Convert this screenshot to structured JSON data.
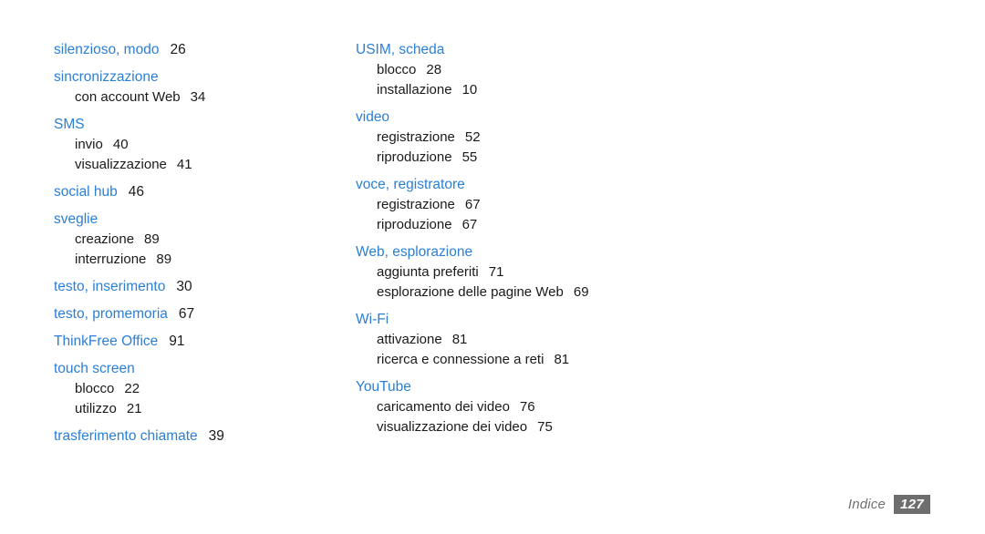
{
  "document": {
    "type": "index-page",
    "language": "it",
    "accent_color": "#2b7fd4",
    "text_color": "#1a1a1a",
    "footer_gray": "#707070",
    "background": "#ffffff"
  },
  "columns": {
    "left": [
      {
        "heading": "silenzioso, modo",
        "page": "26",
        "subentries": []
      },
      {
        "heading": "sincronizzazione",
        "page": "",
        "subentries": [
          {
            "term": "con account Web",
            "page": "34"
          }
        ]
      },
      {
        "heading": "SMS",
        "page": "",
        "subentries": [
          {
            "term": "invio",
            "page": "40"
          },
          {
            "term": "visualizzazione",
            "page": "41"
          }
        ]
      },
      {
        "heading": "social hub",
        "page": "46",
        "subentries": []
      },
      {
        "heading": "sveglie",
        "page": "",
        "subentries": [
          {
            "term": "creazione",
            "page": "89"
          },
          {
            "term": "interruzione",
            "page": "89"
          }
        ]
      },
      {
        "heading": "testo, inserimento",
        "page": "30",
        "subentries": []
      },
      {
        "heading": "testo, promemoria",
        "page": "67",
        "subentries": []
      },
      {
        "heading": "ThinkFree Office",
        "page": "91",
        "subentries": []
      },
      {
        "heading": "touch screen",
        "page": "",
        "subentries": [
          {
            "term": "blocco",
            "page": "22"
          },
          {
            "term": "utilizzo",
            "page": "21"
          }
        ]
      },
      {
        "heading": "trasferimento chiamate",
        "page": "39",
        "subentries": []
      }
    ],
    "right": [
      {
        "heading": "USIM, scheda",
        "page": "",
        "subentries": [
          {
            "term": "blocco",
            "page": "28"
          },
          {
            "term": "installazione",
            "page": "10"
          }
        ]
      },
      {
        "heading": "video",
        "page": "",
        "subentries": [
          {
            "term": "registrazione",
            "page": "52"
          },
          {
            "term": "riproduzione",
            "page": "55"
          }
        ]
      },
      {
        "heading": "voce, registratore",
        "page": "",
        "subentries": [
          {
            "term": "registrazione",
            "page": "67"
          },
          {
            "term": "riproduzione",
            "page": "67"
          }
        ]
      },
      {
        "heading": "Web, esplorazione",
        "page": "",
        "subentries": [
          {
            "term": "aggiunta preferiti",
            "page": "71"
          },
          {
            "term": "esplorazione delle pagine Web",
            "page": "69"
          }
        ]
      },
      {
        "heading": "Wi-Fi",
        "page": "",
        "subentries": [
          {
            "term": "attivazione",
            "page": "81"
          },
          {
            "term": "ricerca e connessione a reti",
            "page": "81"
          }
        ]
      },
      {
        "heading": "YouTube",
        "page": "",
        "subentries": [
          {
            "term": "caricamento dei video",
            "page": "76"
          },
          {
            "term": "visualizzazione dei video",
            "page": "75"
          }
        ]
      }
    ]
  },
  "footer": {
    "label": "Indice",
    "page_number": "127"
  }
}
